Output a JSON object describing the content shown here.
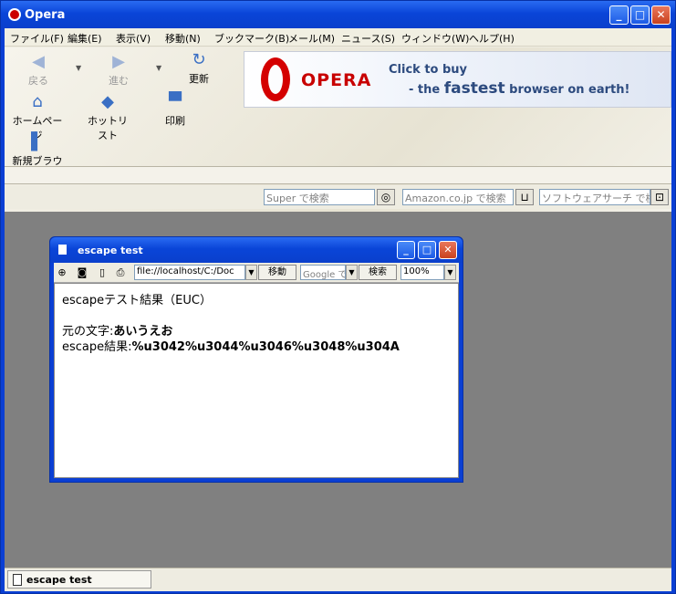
{
  "window": {
    "title": "Opera"
  },
  "menu": [
    "ファイル(F)",
    "編集(E)",
    "表示(V)",
    "移動(N)",
    "ブックマーク(B)",
    "メール(M)",
    "ニュース(S)",
    "ウィンドウ(W)",
    "ヘルプ(H)"
  ],
  "toolbar": {
    "back": "戻る",
    "forward": "進む",
    "refresh": "更新",
    "home": "ホームページ",
    "hotlist": "ホットリスト",
    "print": "印刷",
    "new_browser": "新規ブラウザ"
  },
  "banner": {
    "brand": "OPERA",
    "line1": "Click to buy",
    "line2_pre": "- the",
    "line2_bold": "fastest",
    "line2_post": "browser on earth!"
  },
  "search": {
    "super": "Super で検索",
    "amazon": "Amazon.co.jp で検索",
    "software": "ソフトウェアサーチ で検索"
  },
  "child": {
    "title": "escape test",
    "address": "file://localhost/C:/Doc",
    "go": "移動",
    "google": "Google で",
    "search_btn": "検索",
    "zoom": "100%"
  },
  "content": {
    "heading": "escapeテスト結果（EUC）",
    "orig_label": "元の文字:",
    "orig_value": "あいうえお",
    "esc_label": "escape結果:",
    "esc_value": "%u3042%u3044%u3046%u3048%u304A"
  },
  "status": {
    "tab": "escape test"
  }
}
